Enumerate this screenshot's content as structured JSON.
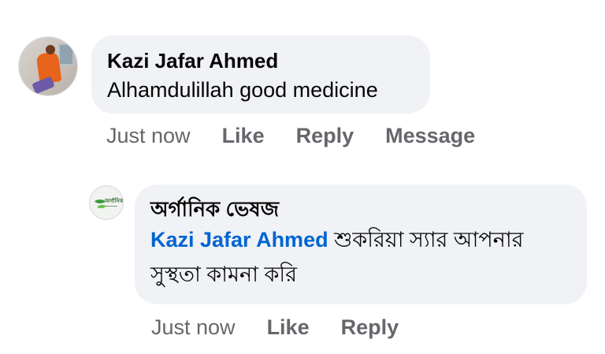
{
  "comment": {
    "author": "Kazi Jafar Ahmed",
    "text": "Alhamdulillah good medicine",
    "timestamp": "Just now",
    "actions": {
      "like": "Like",
      "reply": "Reply",
      "message": "Message"
    },
    "avatar_icon": "user-avatar-photo"
  },
  "reply": {
    "author": "অর্গানিক ভেষজ",
    "mention": "Kazi Jafar Ahmed",
    "text": "শুকরিয়া স্যার আপনার সুস্থতা কামনা করি",
    "timestamp": "Just now",
    "actions": {
      "like": "Like",
      "reply": "Reply"
    },
    "avatar_icon": "organic-leaf-logo",
    "avatar_text": "অর্গানিক"
  },
  "colors": {
    "bubble_bg": "#f0f2f5",
    "mention": "#0064d1",
    "meta_text": "#65676b"
  }
}
